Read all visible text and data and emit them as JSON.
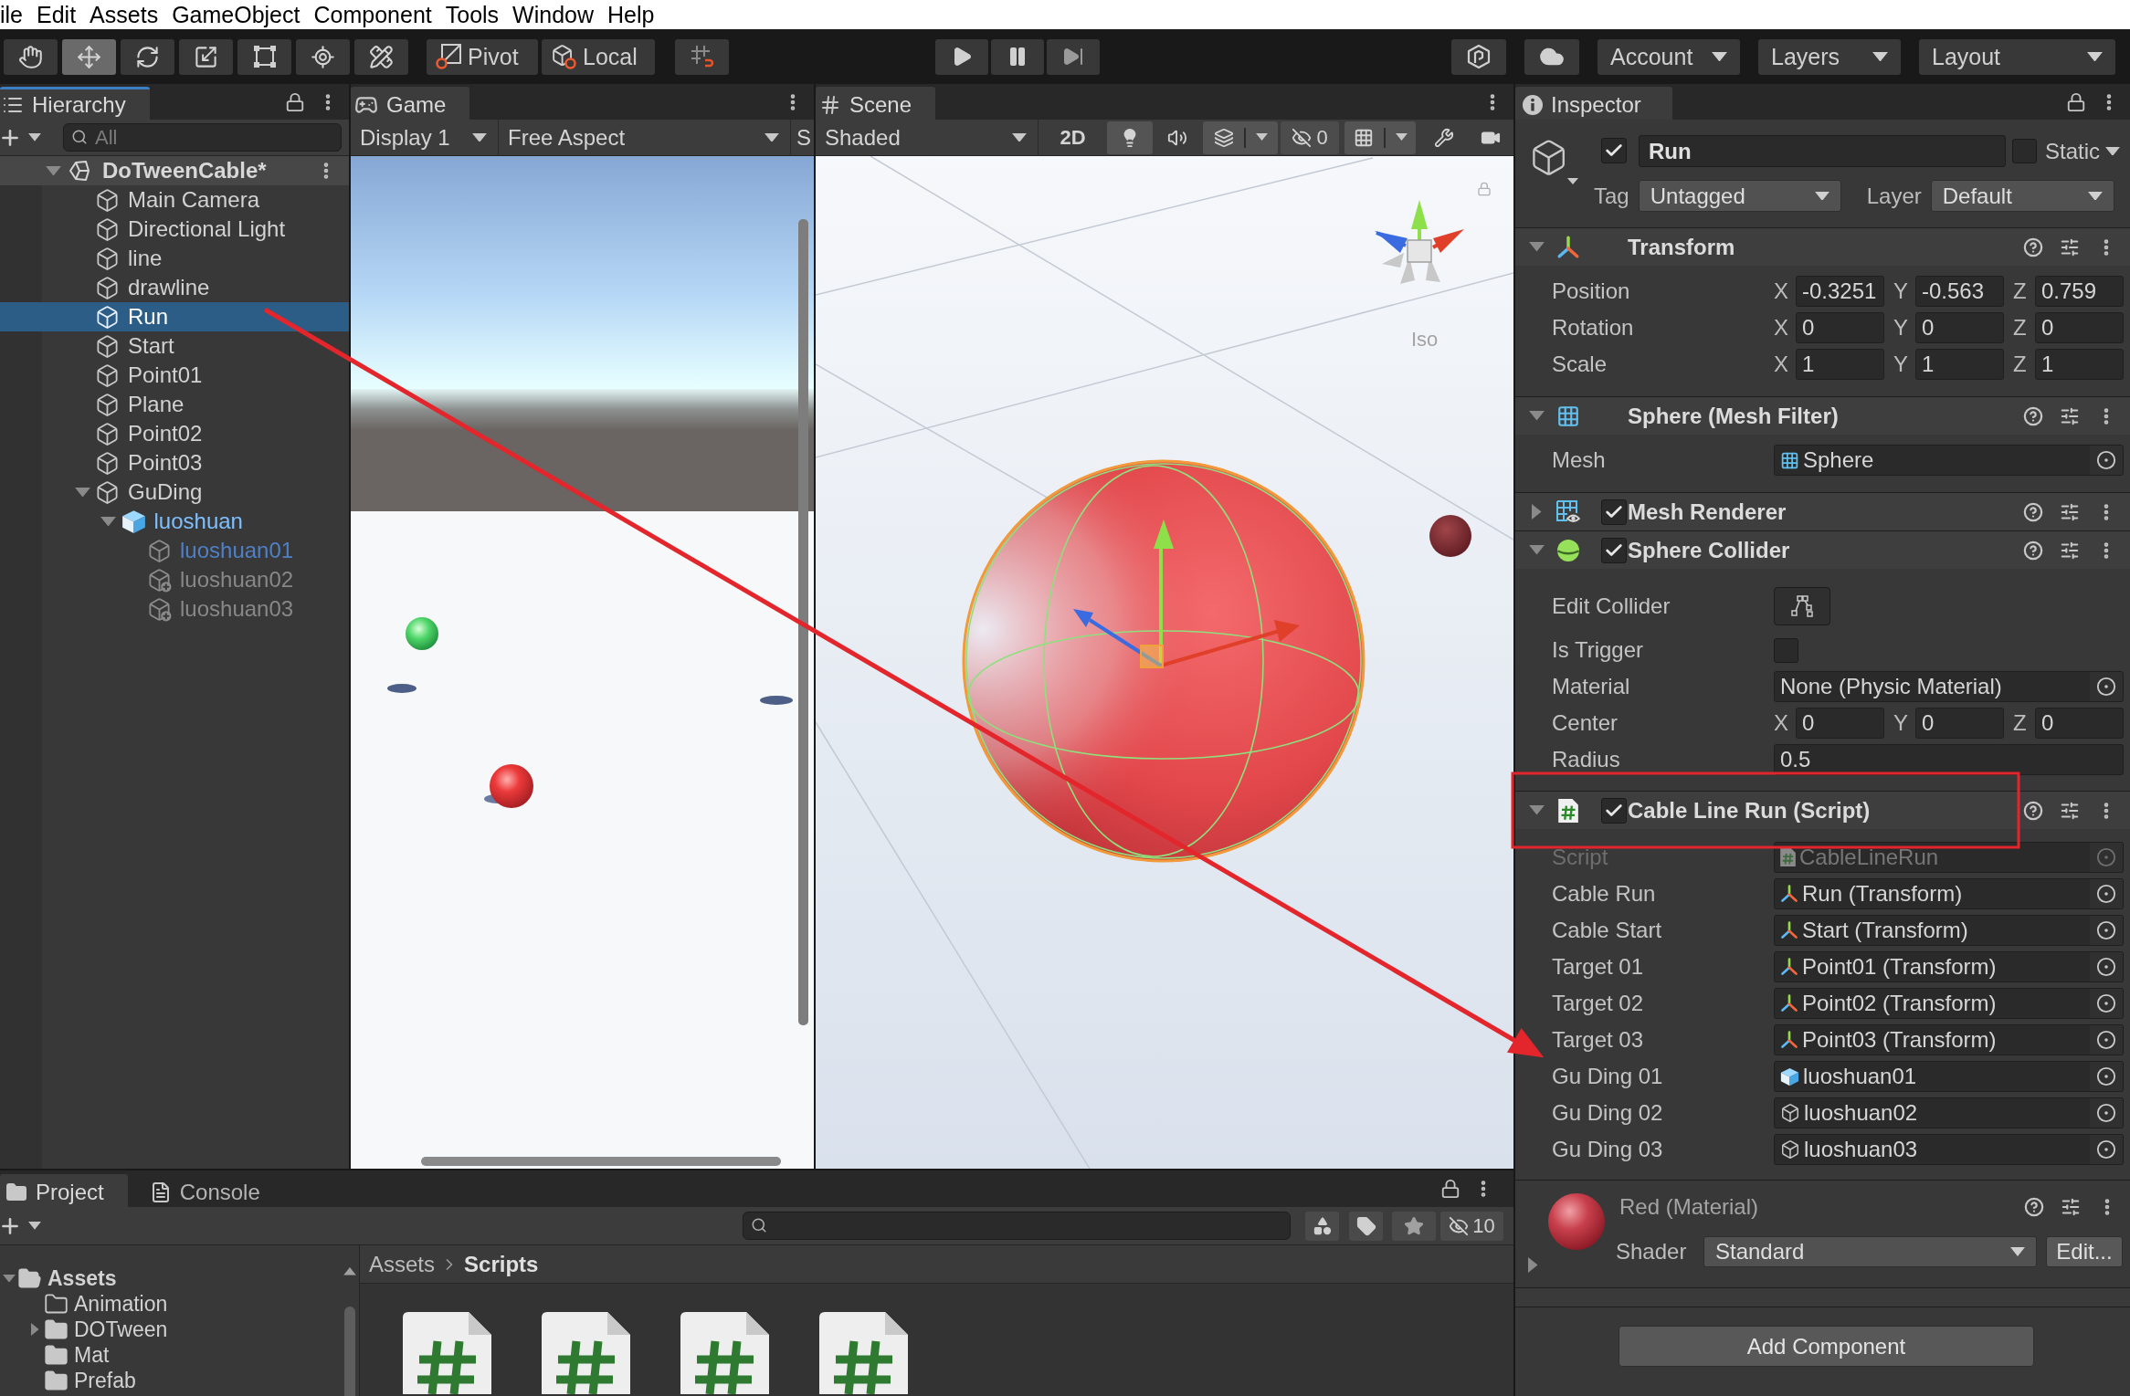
{
  "menu_bar": {
    "items": [
      "ile",
      "Edit",
      "Assets",
      "GameObject",
      "Component",
      "Tools",
      "Window",
      "Help"
    ]
  },
  "toolbar": {
    "tools": [
      {
        "kind": "hand",
        "selected": false
      },
      {
        "kind": "move",
        "selected": true
      },
      {
        "kind": "rotate",
        "selected": false
      },
      {
        "kind": "scale",
        "selected": false
      },
      {
        "kind": "rect",
        "selected": false
      },
      {
        "kind": "transform",
        "selected": false
      },
      {
        "kind": "custom",
        "selected": false
      }
    ],
    "pivot": "Pivot",
    "space": "Local",
    "account": "Account",
    "layers": "Layers",
    "layout": "Layout"
  },
  "hierarchy": {
    "tab": {
      "label": "Hierarchy",
      "focused": true
    },
    "search": {
      "placeholder": "All"
    },
    "scene": {
      "name": "DoTweenCable*",
      "expanded": true
    },
    "items": [
      {
        "name": "Main Camera",
        "kind": "object",
        "selected": false
      },
      {
        "name": "Directional Light",
        "kind": "object",
        "selected": false
      },
      {
        "name": "line",
        "kind": "object",
        "selected": false
      },
      {
        "name": "drawline",
        "kind": "object",
        "selected": false
      },
      {
        "name": "Run",
        "kind": "object",
        "selected": true
      },
      {
        "name": "Start",
        "kind": "object",
        "selected": false
      },
      {
        "name": "Point01",
        "kind": "object",
        "selected": false
      },
      {
        "name": "Plane",
        "kind": "object",
        "selected": false
      },
      {
        "name": "Point02",
        "kind": "object",
        "selected": false
      },
      {
        "name": "Point03",
        "kind": "object",
        "selected": false
      },
      {
        "name": "GuDing",
        "kind": "object",
        "selected": false,
        "expanded": true,
        "children": [
          {
            "name": "luoshuan",
            "kind": "prefab",
            "selected": false,
            "expanded": true,
            "children": [
              {
                "name": "luoshuan01",
                "kind": "prefab_part",
                "selected": false
              },
              {
                "name": "luoshuan02",
                "kind": "added",
                "selected": false
              },
              {
                "name": "luoshuan03",
                "kind": "added",
                "selected": false
              }
            ]
          }
        ]
      }
    ]
  },
  "game": {
    "tab": {
      "label": "Game",
      "focused": false
    },
    "display": "Display 1",
    "aspect": "Free Aspect",
    "scale_label": "S"
  },
  "scene_view": {
    "tab": {
      "label": "Scene",
      "focused": false
    },
    "draw_mode": "Shaded",
    "mode_2d": {
      "label": "2D",
      "on": false
    },
    "toggles": [
      {
        "kind": "lighting",
        "on": true
      },
      {
        "kind": "audio",
        "on": false
      },
      {
        "kind": "effects",
        "on": true
      },
      {
        "kind": "hidden",
        "count": "0"
      },
      {
        "kind": "grid",
        "on": true
      },
      {
        "kind": "tools",
        "on": false
      },
      {
        "kind": "camera",
        "on": false
      }
    ],
    "projection": "Iso"
  },
  "inspector": {
    "tab": {
      "label": "Inspector",
      "focused": false
    },
    "object": {
      "active": true,
      "name": "Run",
      "static": false,
      "static_label": "Static",
      "tag_label": "Tag",
      "tag": "Untagged",
      "layer_label": "Layer",
      "layer": "Default"
    },
    "components": [
      {
        "kind": "transform",
        "title": "Transform",
        "expanded": true,
        "rows": [
          {
            "kind": "vector3",
            "label": "Position",
            "values": [
              {
                "axis": "X",
                "value": "-0.3251"
              },
              {
                "axis": "Y",
                "value": "-0.563"
              },
              {
                "axis": "Z",
                "value": "0.759"
              }
            ]
          },
          {
            "kind": "vector3",
            "label": "Rotation",
            "values": [
              {
                "axis": "X",
                "value": "0"
              },
              {
                "axis": "Y",
                "value": "0"
              },
              {
                "axis": "Z",
                "value": "0"
              }
            ]
          },
          {
            "kind": "vector3",
            "label": "Scale",
            "values": [
              {
                "axis": "X",
                "value": "1"
              },
              {
                "axis": "Y",
                "value": "1"
              },
              {
                "axis": "Z",
                "value": "1"
              }
            ]
          }
        ]
      },
      {
        "kind": "mesh_filter",
        "title": "Sphere (Mesh Filter)",
        "expanded": true,
        "rows": [
          {
            "kind": "object",
            "label": "Mesh",
            "disabled": false,
            "target": {
              "kind": "mesh",
              "name": "Sphere"
            }
          }
        ]
      },
      {
        "kind": "mesh_renderer",
        "title": "Mesh Renderer",
        "expanded": false,
        "enabled": true
      },
      {
        "kind": "sphere_collider",
        "title": "Sphere Collider",
        "expanded": true,
        "enabled": true,
        "rows": [
          {
            "kind": "edit_button",
            "label": "Edit Collider"
          },
          {
            "kind": "checkbox",
            "label": "Is Trigger",
            "checked": false
          },
          {
            "kind": "object",
            "label": "Material",
            "disabled": false,
            "target": {
              "name": "None (Physic Material)"
            }
          },
          {
            "kind": "vector3",
            "label": "Center",
            "values": [
              {
                "axis": "X",
                "value": "0"
              },
              {
                "axis": "Y",
                "value": "0"
              },
              {
                "axis": "Z",
                "value": "0"
              }
            ]
          },
          {
            "kind": "float",
            "label": "Radius",
            "value": "0.5"
          }
        ]
      },
      {
        "kind": "script",
        "title": "Cable Line Run (Script)",
        "expanded": true,
        "enabled": true,
        "rows": [
          {
            "kind": "object",
            "label": "Script",
            "disabled": true,
            "target": {
              "kind": "script",
              "name": "CableLineRun"
            }
          },
          {
            "kind": "object",
            "label": "Cable Run",
            "disabled": false,
            "target": {
              "kind": "transform",
              "name": "Run (Transform)"
            }
          },
          {
            "kind": "object",
            "label": "Cable Start",
            "disabled": false,
            "target": {
              "kind": "transform",
              "name": "Start (Transform)"
            }
          },
          {
            "kind": "object",
            "label": "Target 01",
            "disabled": false,
            "target": {
              "kind": "transform",
              "name": "Point01 (Transform)"
            }
          },
          {
            "kind": "object",
            "label": "Target 02",
            "disabled": false,
            "target": {
              "kind": "transform",
              "name": "Point02 (Transform)"
            }
          },
          {
            "kind": "object",
            "label": "Target 03",
            "disabled": false,
            "target": {
              "kind": "transform",
              "name": "Point03 (Transform)"
            }
          },
          {
            "kind": "object",
            "label": "Gu Ding 01",
            "disabled": false,
            "target": {
              "kind": "prefab",
              "name": "luoshuan01"
            }
          },
          {
            "kind": "object",
            "label": "Gu Ding 02",
            "disabled": false,
            "target": {
              "kind": "gameobject",
              "name": "luoshuan02"
            }
          },
          {
            "kind": "object",
            "label": "Gu Ding 03",
            "disabled": false,
            "target": {
              "kind": "gameobject",
              "name": "luoshuan03"
            }
          }
        ]
      }
    ],
    "material": {
      "title": "Red (Material)",
      "expanded": false,
      "shader_label": "Shader",
      "shader": "Standard",
      "edit": "Edit..."
    },
    "add_component": "Add Component"
  },
  "project": {
    "tabs": [
      {
        "label": "Project",
        "kind": "project",
        "selected": true
      },
      {
        "label": "Console",
        "kind": "console",
        "selected": false
      }
    ],
    "hidden_count": "10",
    "breadcrumb": [
      "Assets",
      "Scripts"
    ],
    "folders": [
      {
        "name": "Assets",
        "empty": false,
        "expanded": true,
        "children": [
          {
            "name": "Animation",
            "empty": true
          },
          {
            "name": "DOTween",
            "empty": false,
            "expanded": false
          },
          {
            "name": "Mat",
            "empty": false
          },
          {
            "name": "Prefab",
            "empty": false
          }
        ]
      }
    ],
    "files": [
      {
        "kind": "script"
      },
      {
        "kind": "script"
      },
      {
        "kind": "script"
      },
      {
        "kind": "script"
      }
    ]
  }
}
